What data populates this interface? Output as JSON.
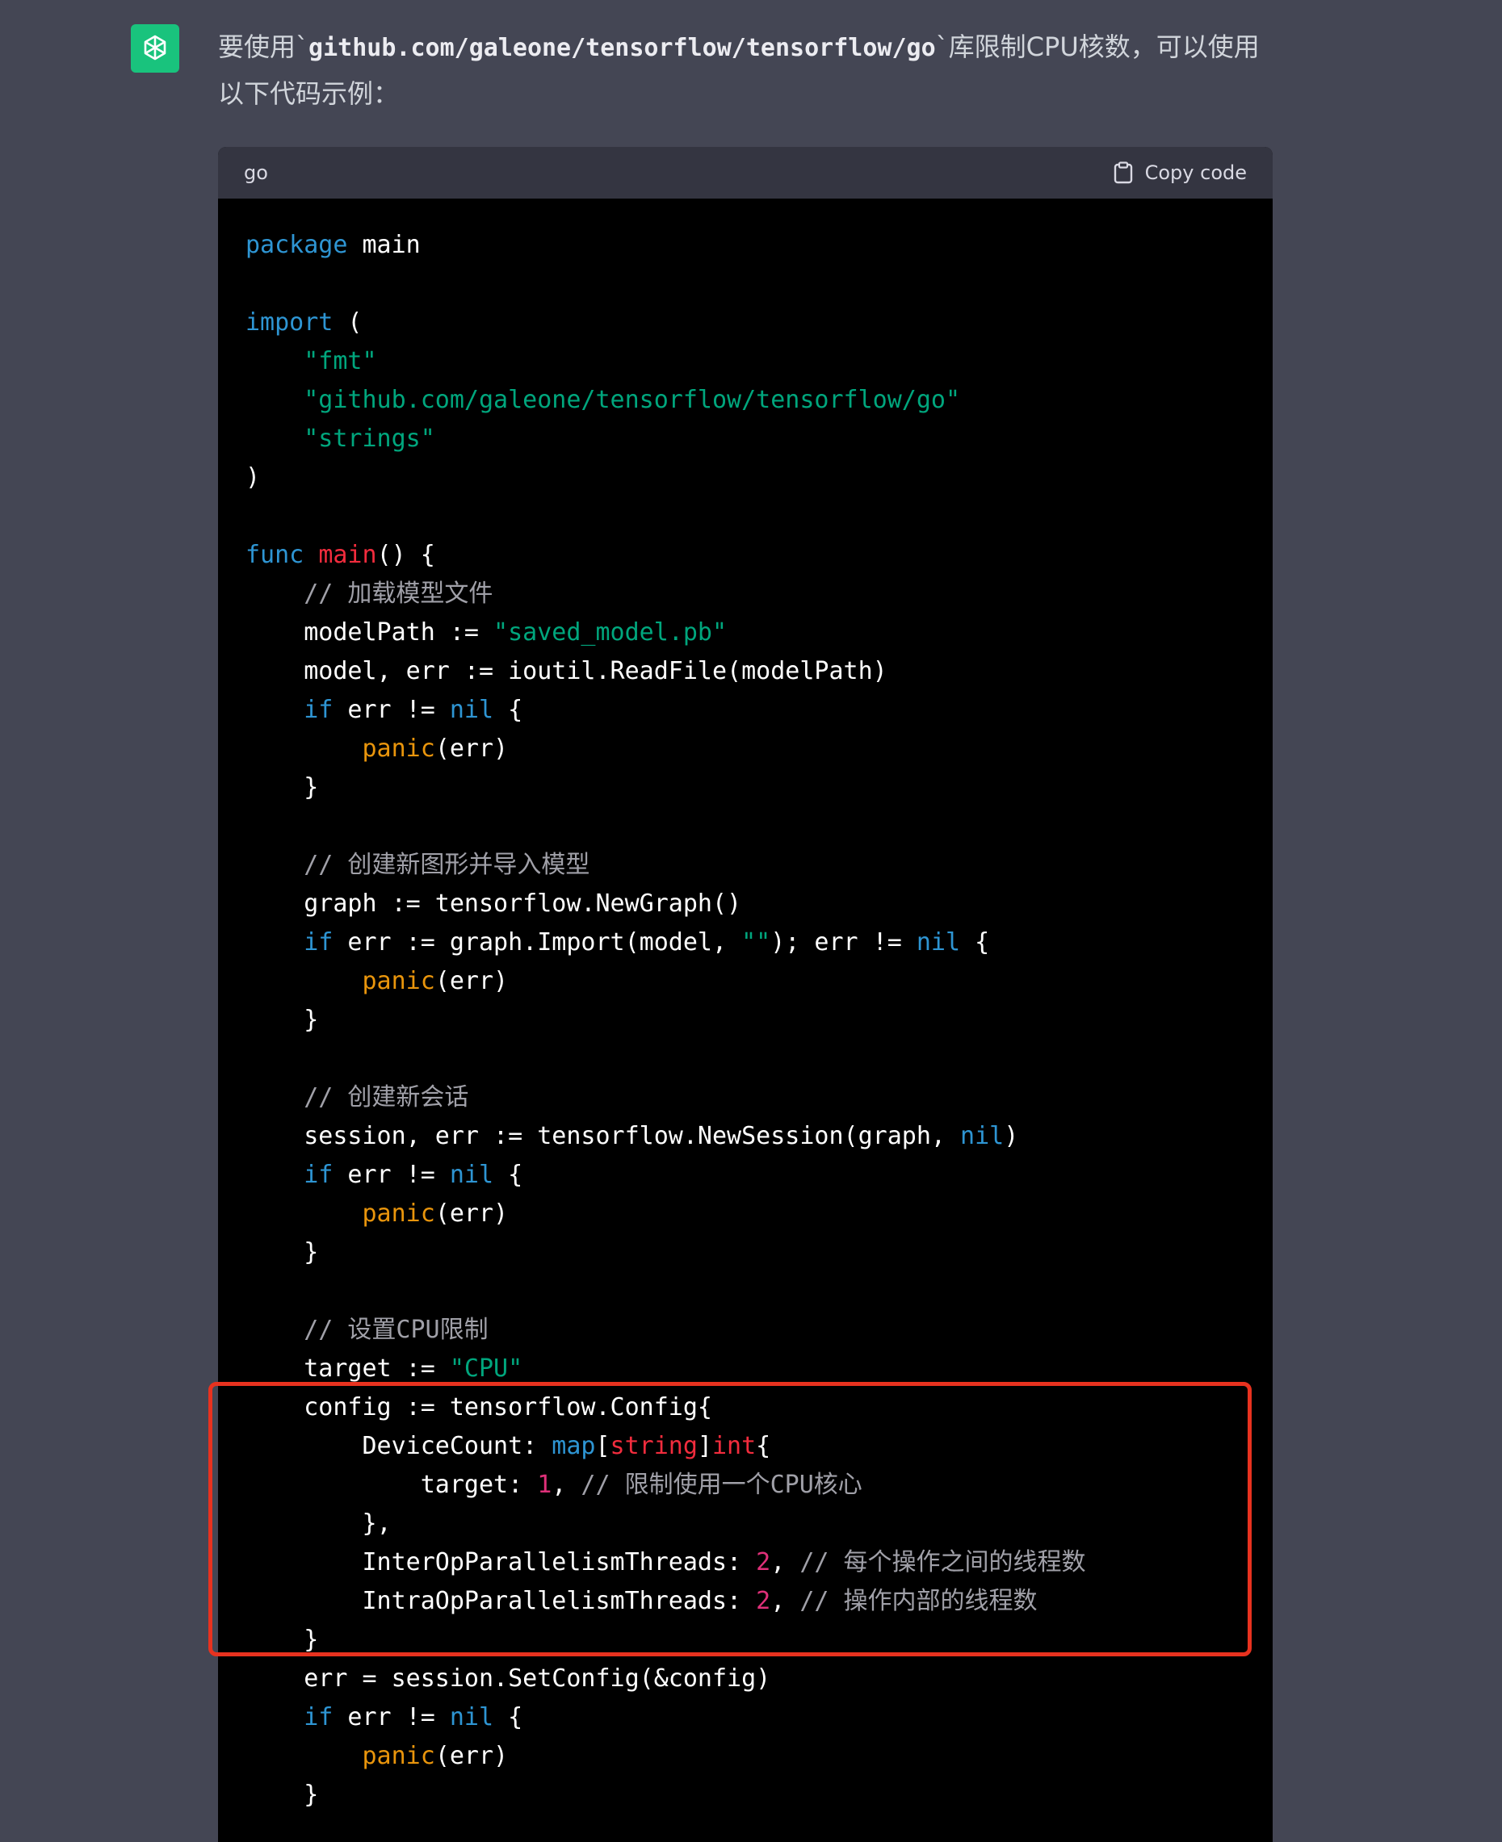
{
  "assistant": {
    "avatar_icon": "openai-logo-icon",
    "avatar_color": "#19c37d"
  },
  "message": {
    "before": "要使用`",
    "code": "github.com/galeone/tensorflow/tensorflow/go",
    "after": "`库限制CPU核数，可以使用以下代码示例："
  },
  "code_block": {
    "language": "go",
    "copy_label": "Copy code",
    "lines": [
      [
        {
          "t": "package",
          "c": "kw"
        },
        {
          "t": " main"
        }
      ],
      [],
      [
        {
          "t": "import",
          "c": "kw"
        },
        {
          "t": " ("
        }
      ],
      [
        {
          "t": "    "
        },
        {
          "t": "\"fmt\"",
          "c": "str"
        }
      ],
      [
        {
          "t": "    "
        },
        {
          "t": "\"github.com/galeone/tensorflow/tensorflow/go\"",
          "c": "str"
        }
      ],
      [
        {
          "t": "    "
        },
        {
          "t": "\"strings\"",
          "c": "str"
        }
      ],
      [
        {
          "t": ")"
        }
      ],
      [],
      [
        {
          "t": "func",
          "c": "kw"
        },
        {
          "t": " "
        },
        {
          "t": "main",
          "c": "fn"
        },
        {
          "t": "() {"
        }
      ],
      [
        {
          "t": "    "
        },
        {
          "t": "// 加载模型文件",
          "c": "cm"
        }
      ],
      [
        {
          "t": "    modelPath := "
        },
        {
          "t": "\"saved_model.pb\"",
          "c": "str"
        }
      ],
      [
        {
          "t": "    model, err := ioutil.ReadFile(modelPath)"
        }
      ],
      [
        {
          "t": "    "
        },
        {
          "t": "if",
          "c": "kw"
        },
        {
          "t": " err != "
        },
        {
          "t": "nil",
          "c": "kw"
        },
        {
          "t": " {"
        }
      ],
      [
        {
          "t": "        "
        },
        {
          "t": "panic",
          "c": "bi"
        },
        {
          "t": "(err)"
        }
      ],
      [
        {
          "t": "    }"
        }
      ],
      [],
      [
        {
          "t": "    "
        },
        {
          "t": "// 创建新图形并导入模型",
          "c": "cm"
        }
      ],
      [
        {
          "t": "    graph := tensorflow.NewGraph()"
        }
      ],
      [
        {
          "t": "    "
        },
        {
          "t": "if",
          "c": "kw"
        },
        {
          "t": " err := graph.Import(model, "
        },
        {
          "t": "\"\"",
          "c": "str"
        },
        {
          "t": "); err != "
        },
        {
          "t": "nil",
          "c": "kw"
        },
        {
          "t": " {"
        }
      ],
      [
        {
          "t": "        "
        },
        {
          "t": "panic",
          "c": "bi"
        },
        {
          "t": "(err)"
        }
      ],
      [
        {
          "t": "    }"
        }
      ],
      [],
      [
        {
          "t": "    "
        },
        {
          "t": "// 创建新会话",
          "c": "cm"
        }
      ],
      [
        {
          "t": "    session, err := tensorflow.NewSession(graph, "
        },
        {
          "t": "nil",
          "c": "kw"
        },
        {
          "t": ")"
        }
      ],
      [
        {
          "t": "    "
        },
        {
          "t": "if",
          "c": "kw"
        },
        {
          "t": " err != "
        },
        {
          "t": "nil",
          "c": "kw"
        },
        {
          "t": " {"
        }
      ],
      [
        {
          "t": "        "
        },
        {
          "t": "panic",
          "c": "bi"
        },
        {
          "t": "(err)"
        }
      ],
      [
        {
          "t": "    }"
        }
      ],
      [],
      [
        {
          "t": "    "
        },
        {
          "t": "// 设置CPU限制",
          "c": "cm"
        }
      ],
      [
        {
          "t": "    target := "
        },
        {
          "t": "\"CPU\"",
          "c": "str"
        }
      ],
      [
        {
          "t": "    config := tensorflow.Config{"
        }
      ],
      [
        {
          "t": "        DeviceCount: "
        },
        {
          "t": "map",
          "c": "kw"
        },
        {
          "t": "["
        },
        {
          "t": "string",
          "c": "fn"
        },
        {
          "t": "]"
        },
        {
          "t": "int",
          "c": "fn"
        },
        {
          "t": "{"
        }
      ],
      [
        {
          "t": "            target: "
        },
        {
          "t": "1",
          "c": "num"
        },
        {
          "t": ", "
        },
        {
          "t": "// 限制使用一个CPU核心",
          "c": "cm"
        }
      ],
      [
        {
          "t": "        },"
        }
      ],
      [
        {
          "t": "        InterOpParallelismThreads: "
        },
        {
          "t": "2",
          "c": "num"
        },
        {
          "t": ", "
        },
        {
          "t": "// 每个操作之间的线程数",
          "c": "cm"
        }
      ],
      [
        {
          "t": "        IntraOpParallelismThreads: "
        },
        {
          "t": "2",
          "c": "num"
        },
        {
          "t": ", "
        },
        {
          "t": "// 操作内部的线程数",
          "c": "cm"
        }
      ],
      [
        {
          "t": "    }"
        }
      ],
      [
        {
          "t": "    err = session.SetConfig(&config)"
        }
      ],
      [
        {
          "t": "    "
        },
        {
          "t": "if",
          "c": "kw"
        },
        {
          "t": " err != "
        },
        {
          "t": "nil",
          "c": "kw"
        },
        {
          "t": " {"
        }
      ],
      [
        {
          "t": "        "
        },
        {
          "t": "panic",
          "c": "bi"
        },
        {
          "t": "(err)"
        }
      ],
      [
        {
          "t": "    }"
        }
      ]
    ]
  },
  "colors": {
    "keyword": "#2e95d3",
    "string": "#00a67d",
    "function": "#f22c3d",
    "builtin": "#e9950c",
    "number": "#df3079",
    "comment": "#a0a0a8",
    "highlight_border": "#e8321f"
  }
}
